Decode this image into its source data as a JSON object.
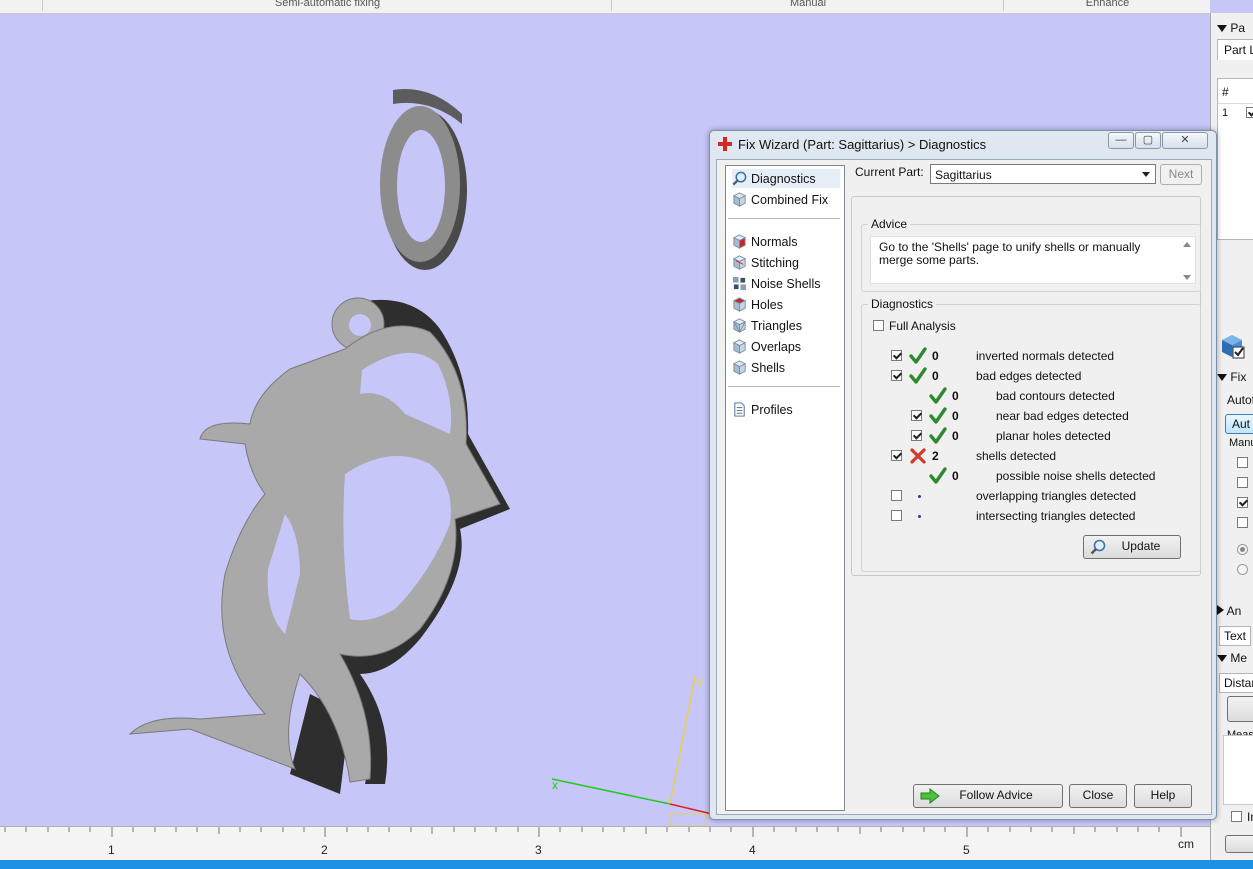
{
  "app": {
    "top_tabs": [
      "Semi-automatic fixing",
      "Manual",
      "Enhance"
    ],
    "ruler": {
      "ticks": [
        "1",
        "2",
        "3",
        "4",
        "5"
      ],
      "unit": "cm"
    },
    "axis_labels": {
      "x": "x",
      "y": "y"
    }
  },
  "right_panel": {
    "header": "Pa",
    "tab": "Part L",
    "table_col": "#",
    "row_index": "1",
    "fix_header": "Fix",
    "autofix_label": "Autof",
    "autofix_button": "Aut",
    "manual_label": "Manu",
    "an_header": "An",
    "text_tab": "Text",
    "me_header": "Me",
    "distance_tab": "Distan",
    "meas_label": "Meas",
    "in_label": "In",
    "checkboxes": [
      false,
      false,
      true,
      false
    ],
    "radios": [
      true,
      false
    ]
  },
  "dialog": {
    "title": "Fix Wizard (Part: Sagittarius) > Diagnostics",
    "window_buttons": {
      "minimize": "—",
      "maximize": "▢",
      "close": "✕"
    },
    "nav_top": [
      {
        "label": "Diagnostics",
        "icon": "magnifier-icon"
      },
      {
        "label": "Combined Fix",
        "icon": "cube-icon"
      }
    ],
    "nav_tools": [
      {
        "label": "Normals",
        "icon": "normals-cube-icon"
      },
      {
        "label": "Stitching",
        "icon": "stitching-cube-icon"
      },
      {
        "label": "Noise Shells",
        "icon": "noise-shells-icon"
      },
      {
        "label": "Holes",
        "icon": "holes-cube-icon"
      },
      {
        "label": "Triangles",
        "icon": "triangles-cube-icon"
      },
      {
        "label": "Overlaps",
        "icon": "overlaps-cube-icon"
      },
      {
        "label": "Shells",
        "icon": "shells-cube-icon"
      }
    ],
    "nav_bottom": [
      {
        "label": "Profiles",
        "icon": "document-icon"
      }
    ],
    "current_part_label": "Current Part:",
    "current_part_value": "Sagittarius",
    "next_button": "Next",
    "advice_title": "Advice",
    "advice_text": "Go to the 'Shells' page to unify shells or manually merge some parts.",
    "diagnostics_title": "Diagnostics",
    "full_analysis_label": "Full Analysis",
    "full_analysis_checked": false,
    "rows": [
      {
        "indent": 0,
        "checkbox": true,
        "checked": true,
        "status": "ok",
        "count": "0",
        "label": "inverted normals detected"
      },
      {
        "indent": 0,
        "checkbox": true,
        "checked": true,
        "status": "ok",
        "count": "0",
        "label": "bad edges detected"
      },
      {
        "indent": 1,
        "checkbox": false,
        "checked": false,
        "status": "ok",
        "count": "0",
        "label": "bad contours detected"
      },
      {
        "indent": 1,
        "checkbox": true,
        "checked": true,
        "status": "ok",
        "count": "0",
        "label": "near bad edges detected"
      },
      {
        "indent": 1,
        "checkbox": true,
        "checked": true,
        "status": "ok",
        "count": "0",
        "label": "planar holes detected"
      },
      {
        "indent": 0,
        "checkbox": true,
        "checked": true,
        "status": "error",
        "count": "2",
        "label": "shells detected"
      },
      {
        "indent": 1,
        "checkbox": false,
        "checked": false,
        "status": "ok",
        "count": "0",
        "label": "possible noise shells detected"
      },
      {
        "indent": 0,
        "checkbox": true,
        "checked": false,
        "status": "none",
        "count": "",
        "label": "overlapping triangles detected"
      },
      {
        "indent": 0,
        "checkbox": true,
        "checked": false,
        "status": "none",
        "count": "",
        "label": "intersecting triangles detected"
      }
    ],
    "update_button": "Update",
    "follow_advice_button": "Follow Advice",
    "close_button": "Close",
    "help_button": "Help"
  }
}
